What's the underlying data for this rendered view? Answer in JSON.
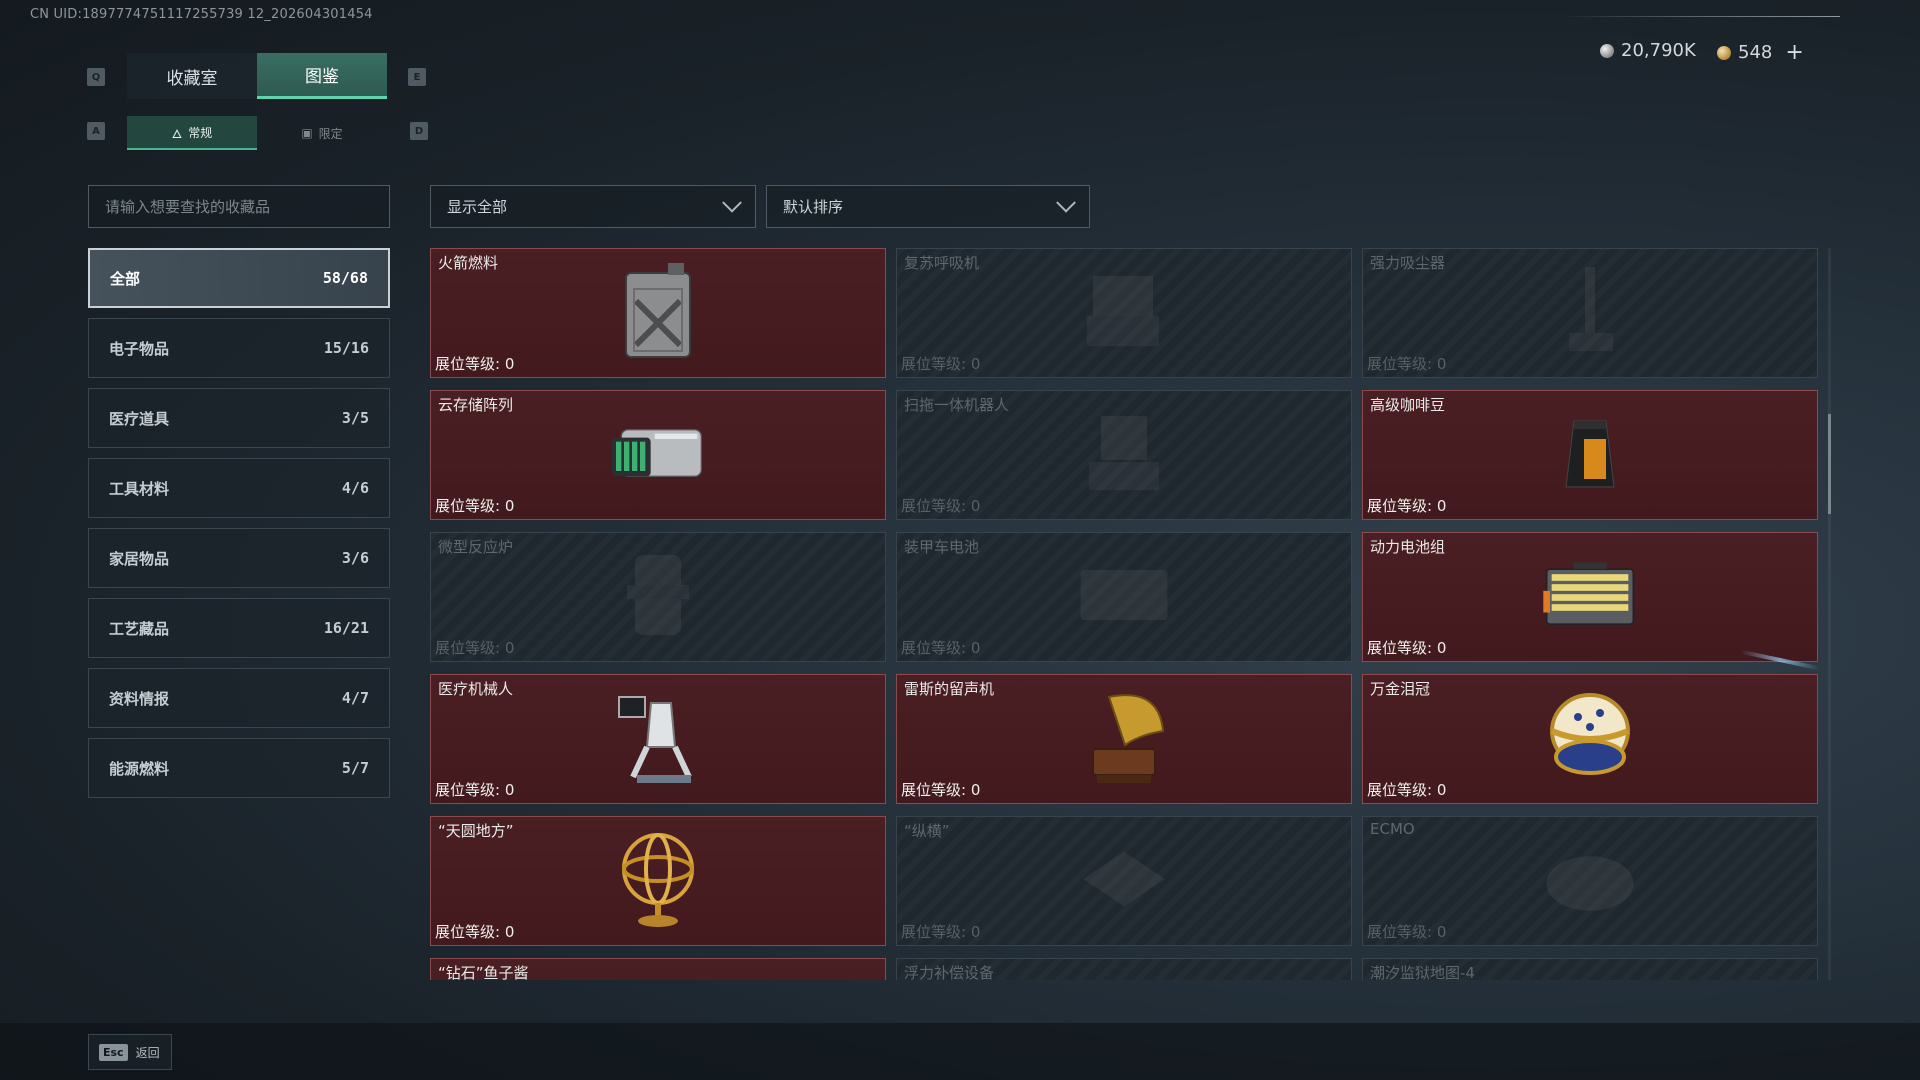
{
  "uid": "CN UID:1897774751117255739 12_202604301454",
  "top_tabs": {
    "key_left": "Q",
    "key_right": "E",
    "items": [
      "收藏室",
      "图鉴"
    ],
    "active": 1
  },
  "sub_tabs": {
    "key_left": "A",
    "key_right": "D",
    "items": [
      "常规",
      "限定"
    ],
    "active": 0
  },
  "currency": {
    "silver": "20,790K",
    "gold": "548"
  },
  "search": {
    "placeholder": "请输入想要查找的收藏品"
  },
  "categories": [
    {
      "label": "全部",
      "count": "58/68",
      "active": true
    },
    {
      "label": "电子物品",
      "count": "15/16"
    },
    {
      "label": "医疗道具",
      "count": "3/5"
    },
    {
      "label": "工具材料",
      "count": "4/6"
    },
    {
      "label": "家居物品",
      "count": "3/6"
    },
    {
      "label": "工艺藏品",
      "count": "16/21"
    },
    {
      "label": "资料情报",
      "count": "4/7"
    },
    {
      "label": "能源燃料",
      "count": "5/7"
    }
  ],
  "filters": {
    "show": "显示全部",
    "sort": "默认排序"
  },
  "level_label": "展位等级: 0",
  "items": [
    {
      "name": "火箭燃料",
      "owned": true,
      "icon": "fuel-can"
    },
    {
      "name": "复苏呼吸机",
      "owned": false,
      "icon": "ventilator"
    },
    {
      "name": "强力吸尘器",
      "owned": false,
      "icon": "vacuum"
    },
    {
      "name": "云存储阵列",
      "owned": true,
      "icon": "server"
    },
    {
      "name": "扫拖一体机器人",
      "owned": false,
      "icon": "robot-cleaner"
    },
    {
      "name": "高级咖啡豆",
      "owned": true,
      "icon": "coffee-bag"
    },
    {
      "name": "微型反应炉",
      "owned": false,
      "icon": "reactor"
    },
    {
      "name": "装甲车电池",
      "owned": false,
      "icon": "battery"
    },
    {
      "name": "动力电池组",
      "owned": true,
      "icon": "battery-pack"
    },
    {
      "name": "医疗机械人",
      "owned": true,
      "icon": "med-robot"
    },
    {
      "name": "雷斯的留声机",
      "owned": true,
      "icon": "gramophone"
    },
    {
      "name": "万金泪冠",
      "owned": true,
      "icon": "jeweled-egg"
    },
    {
      "name": "“天圆地方”",
      "owned": true,
      "icon": "armillary"
    },
    {
      "name": "“纵横”",
      "owned": false,
      "icon": "chessboard"
    },
    {
      "name": "ECMO",
      "owned": false,
      "icon": "ecmo"
    },
    {
      "name": "“钻石”鱼子酱",
      "owned": true,
      "icon": "caviar"
    },
    {
      "name": "浮力补偿设备",
      "owned": false,
      "icon": "bcd"
    },
    {
      "name": "潮汐监狱地图-4",
      "owned": false,
      "icon": "map"
    }
  ],
  "footer": {
    "esc_key": "Esc",
    "back": "返回"
  }
}
